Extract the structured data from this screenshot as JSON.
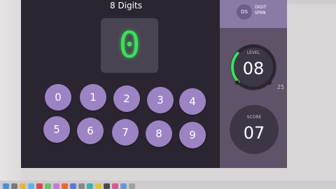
{
  "app": {
    "title": "8 Digits",
    "display_digit": "0"
  },
  "keypad": {
    "keys": [
      "0",
      "1",
      "2",
      "3",
      "4",
      "5",
      "6",
      "7",
      "8",
      "9"
    ]
  },
  "sidebar": {
    "logo_text": "DS",
    "brand_line1": "DIGIT",
    "brand_line2": "SPAN",
    "level_label": "LEVEL",
    "level_value": "08",
    "level_max": "25",
    "score_label": "SCORE",
    "score_value": "07"
  },
  "colors": {
    "app_background": "#2a2530",
    "sidebar_background": "#5e5369",
    "brand_bar": "#8a7aa6",
    "key_fill": "#9c84c4",
    "display_digit": "#39e05a",
    "progress_arc": "#39e05a"
  },
  "level_progress": 0.32
}
